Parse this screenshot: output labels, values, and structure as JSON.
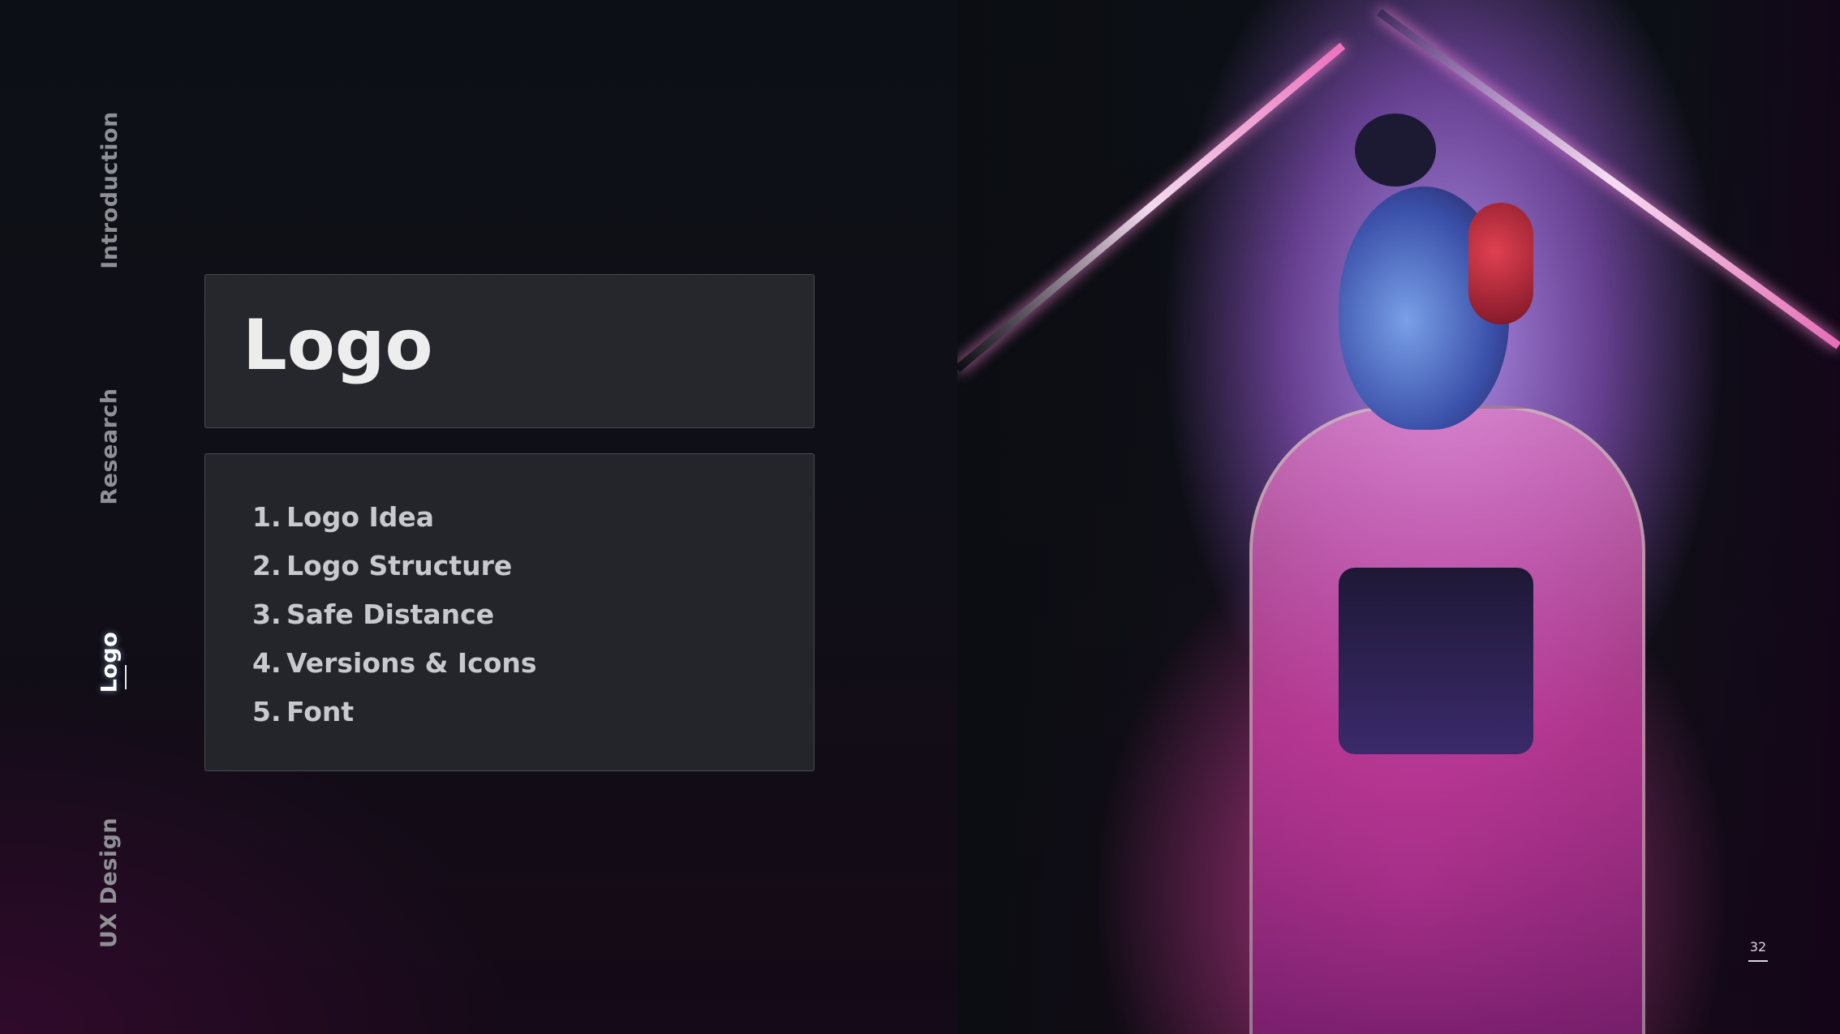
{
  "nav": {
    "items": [
      {
        "label": "Introduction"
      },
      {
        "label": "Research"
      },
      {
        "label": "Logo",
        "active": true
      },
      {
        "label": "UX Design"
      }
    ]
  },
  "title": "Logo",
  "agenda": [
    {
      "number": "1.",
      "label": "Logo Idea"
    },
    {
      "number": "2.",
      "label": "Logo Structure"
    },
    {
      "number": "3.",
      "label": "Safe Distance"
    },
    {
      "number": "4.",
      "label": "Versions & Icons"
    },
    {
      "number": "5.",
      "label": "Font"
    }
  ],
  "page_number": "32",
  "colors": {
    "background": "#0b0d12",
    "card": "#26272c",
    "title_text": "#ededed",
    "list_text": "#c9c9cd",
    "nav_text": "#8f9096",
    "nav_active": "#ffffff",
    "neon_pink": "#ff78c8",
    "neon_violet": "#b996f5"
  }
}
